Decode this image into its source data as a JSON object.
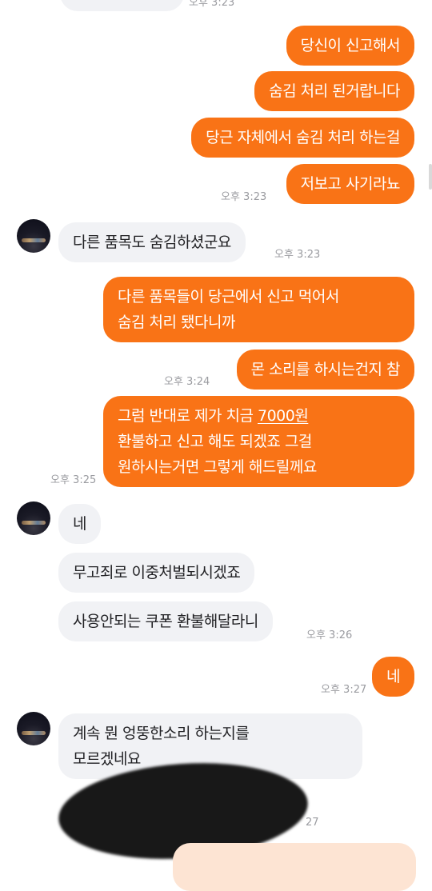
{
  "messages": {
    "top_in_time": "오후 3:23",
    "out1": "당신이 신고해서",
    "out2": "숨김 처리 된거랍니다",
    "out3": "당근 자체에서 숨김 처리 하는걸",
    "out4": "저보고 사기라뇨",
    "out_time1": "오후 3:23",
    "in1": "다른 품목도 숨김하셨군요",
    "in_time1": "오후 3:23",
    "out5_line1": "다른 품목들이 당근에서 신고 먹어서",
    "out5_line2": "숨김 처리 됐다니까",
    "out6": "몬 소리를 하시는건지 참",
    "out_time2": "오후 3:24",
    "out7_line1_a": "그럼 반대로 제가 치금 ",
    "out7_line1_amount": "7000원",
    "out7_line2": "환불하고 신고 해도 되겠죠 그걸",
    "out7_line3": "원하시는거면 그렇게 해드릴께요",
    "out_time3": "오후 3:25",
    "in2": "네",
    "in3": "무고죄로 이중처벌되시겠죠",
    "in4": "사용안되는 쿠폰 환불해달라니",
    "in_time2": "오후 3:26",
    "out8": "네",
    "out_time4": "오후 3:27",
    "in5_line1": "계속 뭔 엉뚱한소리 하는지를",
    "in5_line2": "모르겠네요",
    "in_time3_partial": "27"
  },
  "colors": {
    "outgoing_bubble": "#f97316",
    "incoming_bubble": "#f1f2f5",
    "timestamp": "#9a9ba0"
  }
}
